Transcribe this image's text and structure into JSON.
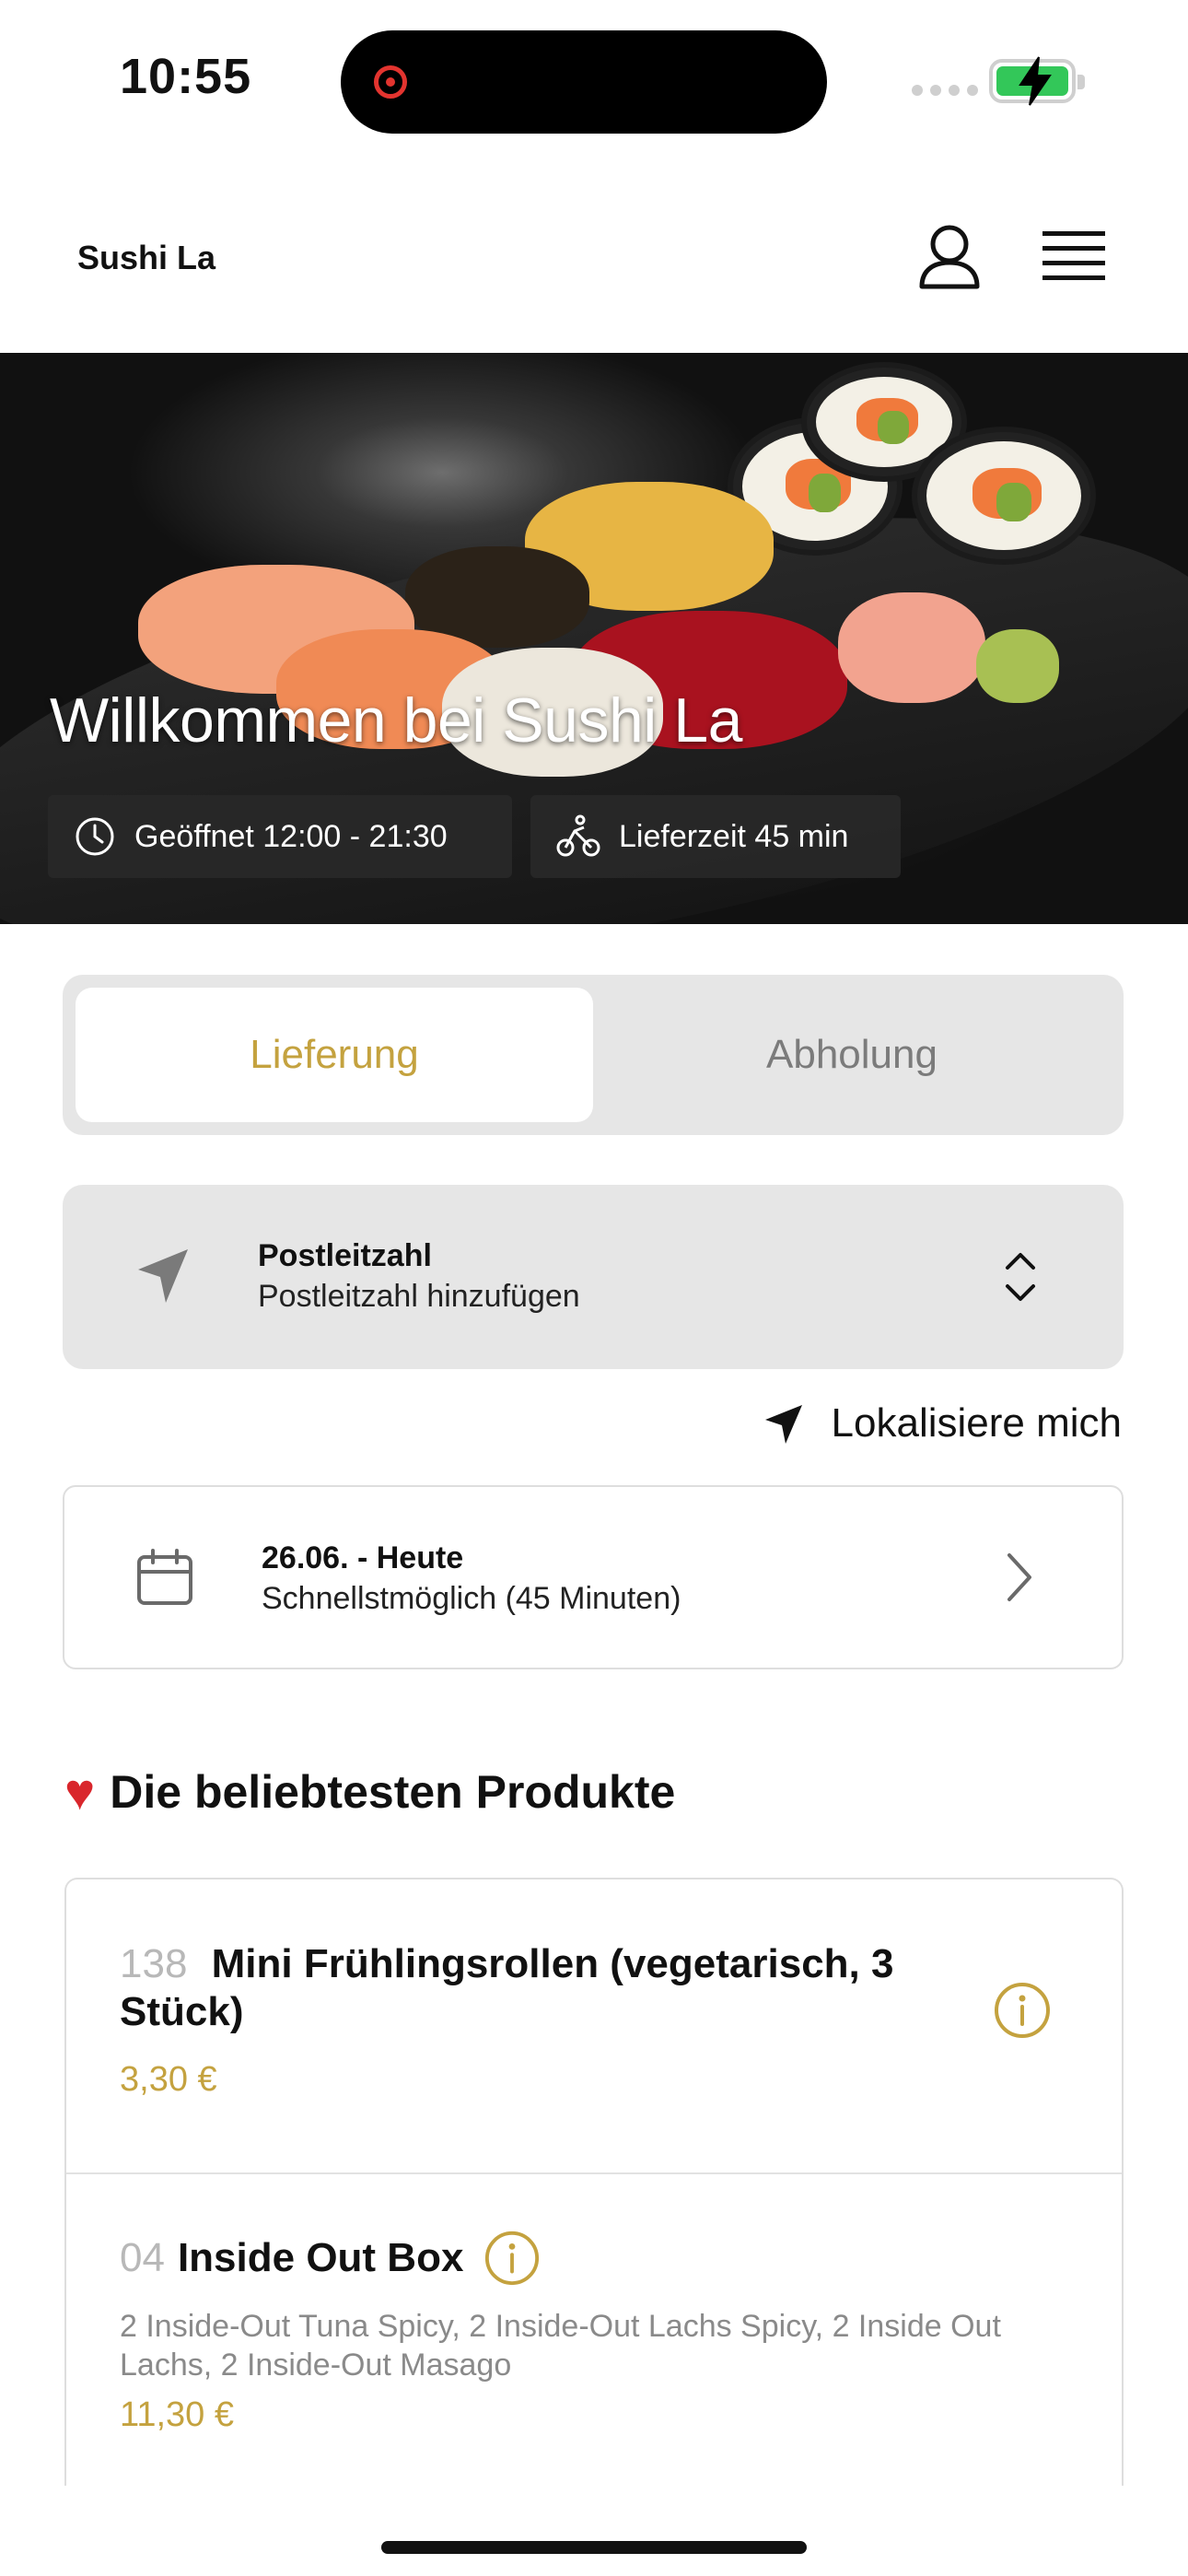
{
  "status_bar": {
    "time": "10:55"
  },
  "header": {
    "brand": "Sushi La"
  },
  "hero": {
    "title": "Willkommen bei Sushi La",
    "opening_hours": "Geöffnet 12:00 - 21:30",
    "delivery_time": "Lieferzeit 45 min"
  },
  "mode_toggle": {
    "delivery": "Lieferung",
    "pickup": "Abholung",
    "selected": "Lieferung"
  },
  "postcode": {
    "label": "Postleitzahl",
    "placeholder": "Postleitzahl hinzufügen"
  },
  "locate": {
    "label": "Lokalisiere mich"
  },
  "date": {
    "title": "26.06. - Heute",
    "subtitle": "Schnellstmöglich (45 Minuten)"
  },
  "popular": {
    "heading": "Die beliebtesten Produkte",
    "items": [
      {
        "number": "138",
        "name": "Mini Frühlingsrollen (vegetarisch, 3 Stück)",
        "price": "3,30 €"
      },
      {
        "number": "04",
        "name": "Inside Out Box",
        "description": "2 Inside-Out Tuna Spicy, 2 Inside-Out Lachs Spicy, 2 Inside Out Lachs, 2 Inside-Out Masago",
        "price": "11,30 €"
      }
    ]
  },
  "colors": {
    "accent": "#c4a23f",
    "toggle_bg": "#e6e6e6",
    "battery": "#33c759",
    "heart": "#d9262c"
  }
}
